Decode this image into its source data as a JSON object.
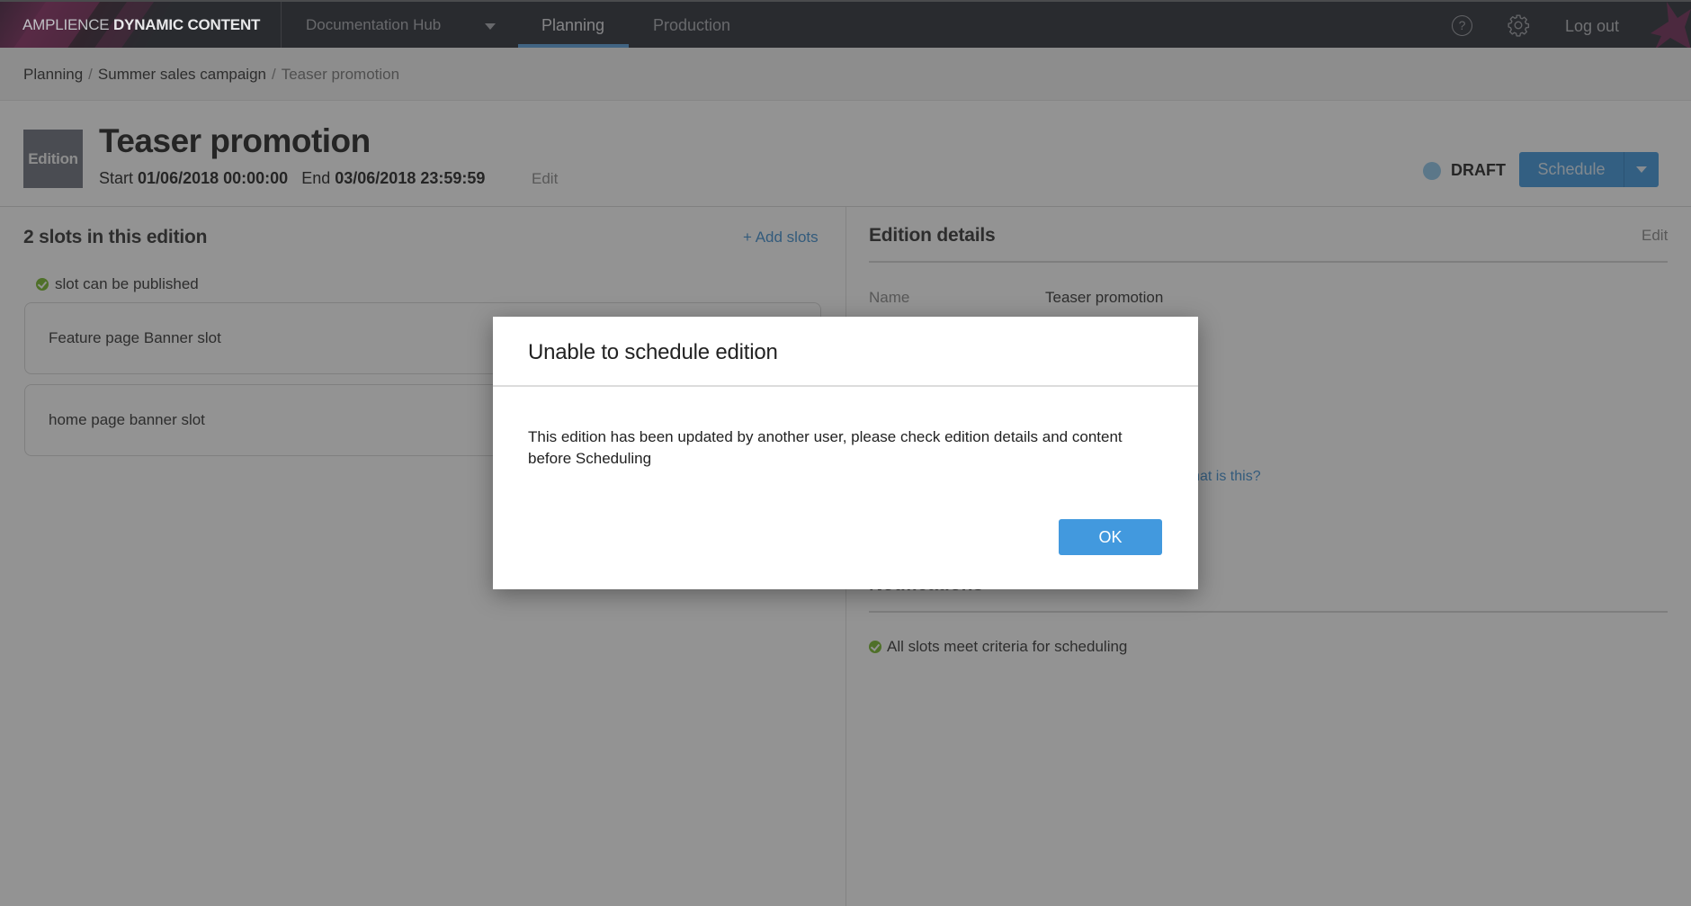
{
  "topnav": {
    "brand_light": "AMPLIENCE",
    "brand_bold": "DYNAMIC CONTENT",
    "hub_name": "Documentation Hub",
    "tabs": [
      {
        "label": "Planning",
        "active": true
      },
      {
        "label": "Production",
        "active": false
      }
    ],
    "help_icon": "?",
    "logout_label": "Log out",
    "accent_color": "#5aa0dc"
  },
  "breadcrumb": {
    "items": [
      "Planning",
      "Summer sales campaign",
      "Teaser promotion"
    ],
    "separator": "/"
  },
  "header": {
    "badge": "Edition",
    "title": "Teaser promotion",
    "start_label": "Start",
    "start_value": "01/06/2018 00:00:00",
    "end_label": "End",
    "end_value": "03/06/2018 23:59:59",
    "edit_label": "Edit",
    "status": "DRAFT",
    "status_color": "#8fc7ea",
    "schedule_label": "Schedule"
  },
  "slots": {
    "title": "2 slots in this edition",
    "add_label": "+ Add slots",
    "publish_status": "slot can be published",
    "items": [
      {
        "name": "Feature page Banner slot"
      },
      {
        "name": "home page banner slot"
      }
    ]
  },
  "details": {
    "title": "Edition details",
    "edit_label": "Edit",
    "name_label": "Name",
    "name_value": "Teaser promotion",
    "whatis_link": "What is this?",
    "notifications_title": "Notifications",
    "notification": "All slots meet criteria for scheduling"
  },
  "modal": {
    "title": "Unable to schedule edition",
    "message": "This edition has been updated by another user, please check edition details and content before Scheduling",
    "ok_label": "OK",
    "button_color": "#4299de"
  }
}
